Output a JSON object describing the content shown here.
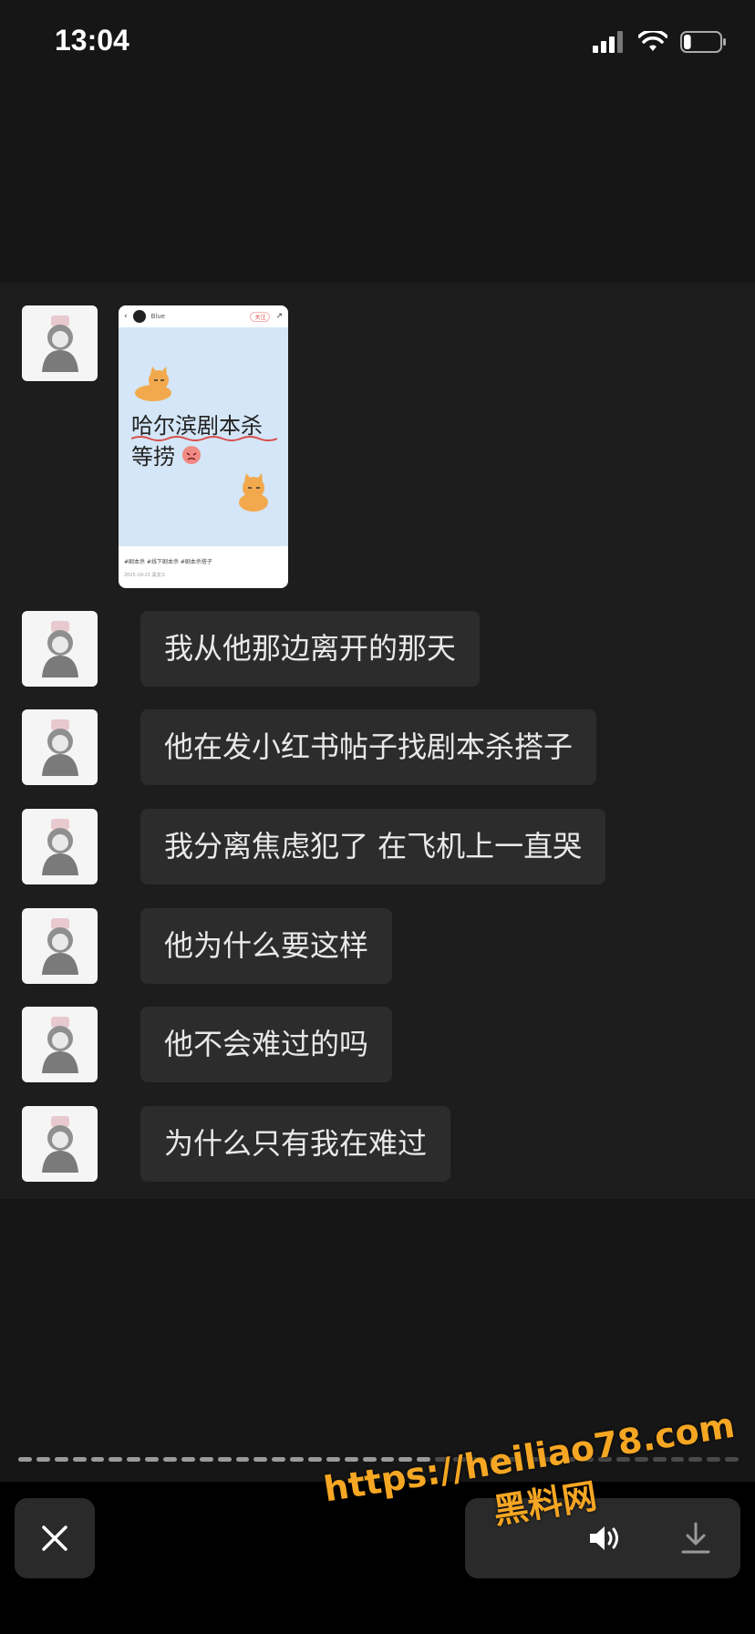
{
  "status_bar": {
    "time": "13:04",
    "battery_level": 0.2
  },
  "card": {
    "username": "Blue",
    "follow_label": "关注",
    "title_line1": "哈尔滨剧本杀",
    "title_line2": "等捞",
    "tags": "#剧本杀 #线下剧本杀 #剧本杀搭子",
    "date": "2025-10-21 黑龙江"
  },
  "messages": [
    {
      "text": "我从他那边离开的那天"
    },
    {
      "text": "他在发小红书帖子找剧本杀搭子"
    },
    {
      "text": "我分离焦虑犯了 在飞机上一直哭"
    },
    {
      "text": "他为什么要这样"
    },
    {
      "text": "他不会难过的吗"
    },
    {
      "text": "为什么只有我在难过"
    }
  ],
  "progress": {
    "total_segments": 40,
    "viewed_segments": 23
  },
  "toolbar": {
    "icons": [
      "close-icon",
      "speaker-icon",
      "download-icon"
    ]
  },
  "watermark": {
    "url": "https://heiliao78.com",
    "name": "黑料网"
  },
  "colors": {
    "background": "#161616",
    "bubble": "#2c2c2c",
    "accent_watermark": "#f5a623"
  }
}
